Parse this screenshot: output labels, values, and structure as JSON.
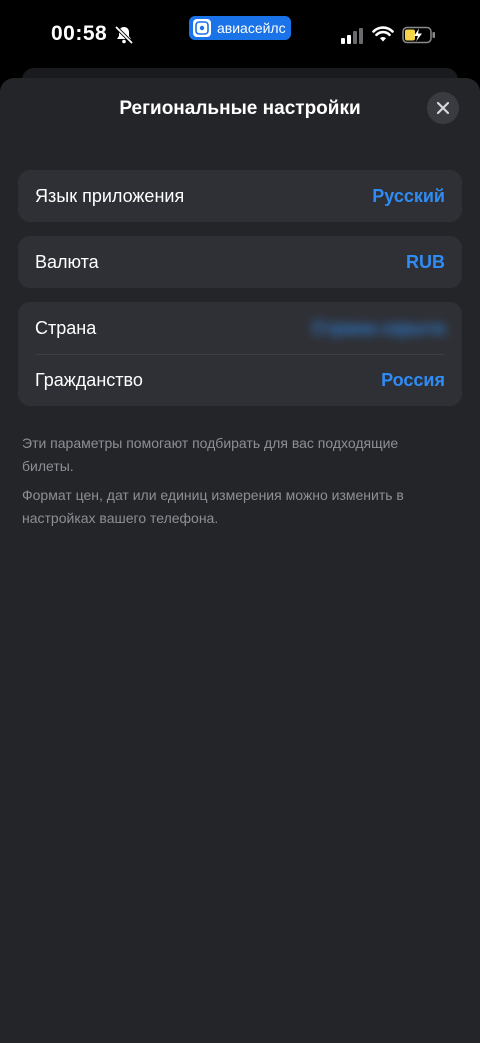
{
  "status_bar": {
    "time": "00:58",
    "app_pill_label": "авиасейлс",
    "icons": [
      "bell-slash-icon",
      "cellular-signal-icon",
      "wifi-icon",
      "battery-charging-icon"
    ]
  },
  "sheet": {
    "title": "Региональные настройки",
    "close_icon": "close-icon"
  },
  "settings": {
    "language": {
      "label": "Язык приложения",
      "value": "Русский"
    },
    "currency": {
      "label": "Валюта",
      "value": "RUB"
    },
    "country": {
      "label": "Страна",
      "value": "Страна скрыта"
    },
    "citizenship": {
      "label": "Гражданство",
      "value": "Россия"
    }
  },
  "notes": {
    "line1": "Эти параметры помогают подбирать для вас подходящие билеты.",
    "line2": "Формат цен, дат или единиц измерения можно изменить в настройках вашего телефона."
  },
  "colors": {
    "accent": "#2f8cf4",
    "sheet_bg": "#242529",
    "group_bg": "#2f3035",
    "app_pill_bg": "#1a73e8",
    "battery_yellow": "#f5d547"
  }
}
